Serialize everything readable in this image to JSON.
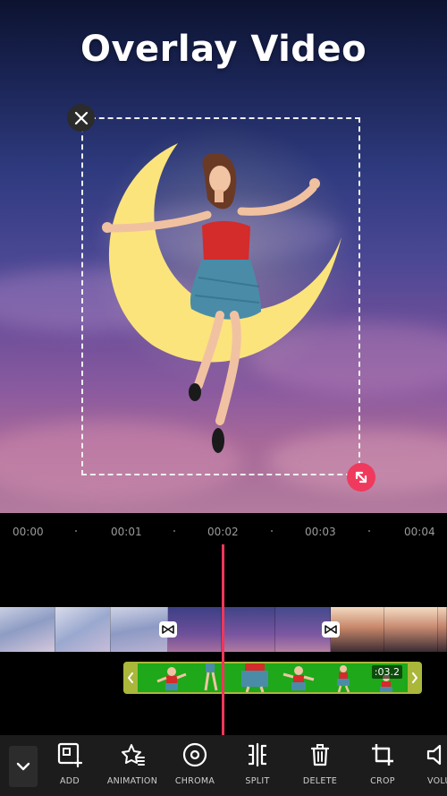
{
  "preview": {
    "title": "Overlay Video",
    "close_icon": "close-icon",
    "resize_icon": "resize-diagonal-icon"
  },
  "timeline": {
    "ruler": [
      "00:00",
      "00:01",
      "00:02",
      "00:03",
      "00:04"
    ],
    "transition_icon": "bowtie-transition-icon",
    "overlay_clip": {
      "duration": ":03.2",
      "left_handle_icon": "chevron-left-icon",
      "right_handle_icon": "chevron-right-icon"
    },
    "playhead_color": "#f0365a"
  },
  "toolbar": {
    "collapse_icon": "chevron-down-icon",
    "tools": [
      {
        "label": "ADD",
        "icon": "add-overlay-icon"
      },
      {
        "label": "ANIMATION",
        "icon": "animation-icon"
      },
      {
        "label": "CHROMA",
        "icon": "chroma-icon"
      },
      {
        "label": "SPLIT",
        "icon": "split-icon"
      },
      {
        "label": "DELETE",
        "icon": "trash-icon"
      },
      {
        "label": "CROP",
        "icon": "crop-icon"
      },
      {
        "label": "VOLU",
        "icon": "volume-icon"
      }
    ]
  },
  "colors": {
    "accent": "#f0365a",
    "resize_button": "#ef3a5d",
    "overlay_track": "#aab73b",
    "chroma_green": "#1ea81a",
    "toolbar_bg": "#1c1c1c"
  }
}
